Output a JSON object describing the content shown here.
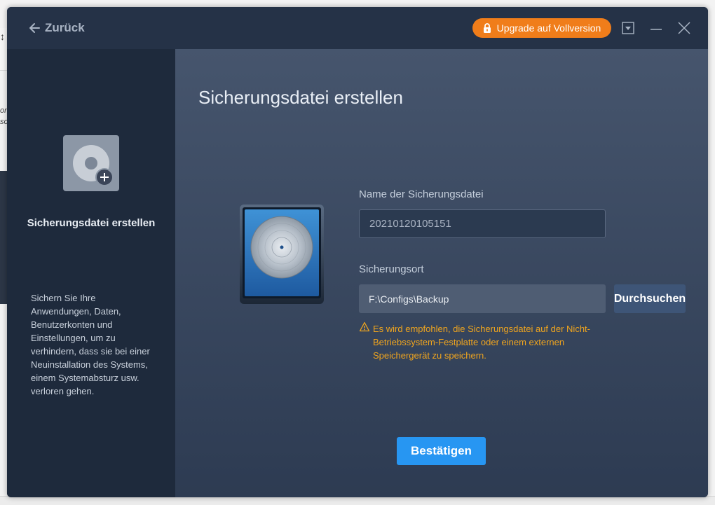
{
  "titlebar": {
    "back_label": "Zurück",
    "upgrade_label": "Upgrade auf Vollversion"
  },
  "background": {
    "fragment_1": "on",
    "fragment_2": "so"
  },
  "sidebar": {
    "title": "Sicherungsdatei erstellen",
    "description": "Sichern Sie Ihre Anwendungen, Daten, Benutzerkonten und Einstellungen, um zu verhindern, dass sie bei einer Neuinstallation des Systems, einem Systemabsturz usw. verloren gehen."
  },
  "main": {
    "title": "Sicherungsdatei erstellen",
    "name_label": "Name der Sicherungsdatei",
    "name_value": "20210120105151",
    "location_label": "Sicherungsort",
    "location_value": "F:\\Configs\\Backup",
    "browse_label": "Durchsuchen",
    "warning": "Es wird empfohlen, die Sicherungsdatei auf der Nicht-Betriebssystem-Festplatte oder einem externen Speichergerät zu speichern.",
    "confirm_label": "Bestätigen"
  },
  "colors": {
    "accent": "#2796f2",
    "upgrade": "#f07d1a",
    "warning": "#f0a51e",
    "sidebar_bg": "#1e2a3c",
    "content_bg": "#3a4860"
  },
  "icons": [
    "back-arrow-icon",
    "lock-icon",
    "dropdown-icon",
    "minimize-icon",
    "close-icon",
    "backup-file-icon",
    "plus-icon",
    "disk-icon",
    "warning-icon"
  ]
}
